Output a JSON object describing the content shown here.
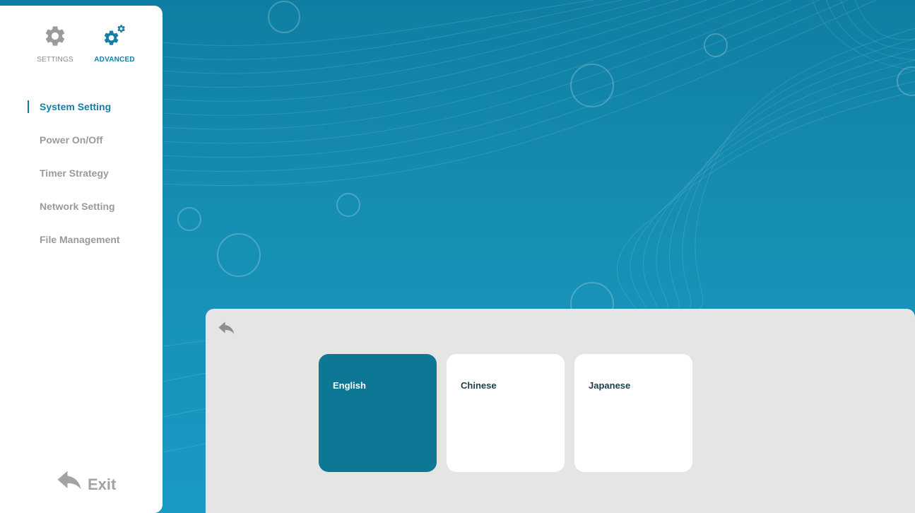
{
  "sidebar": {
    "modes": [
      {
        "label": "SETTINGS",
        "icon": "gear-icon"
      },
      {
        "label": "ADVANCED",
        "icon": "advanced-gears-icon"
      }
    ],
    "items": [
      {
        "label": "System Setting"
      },
      {
        "label": "Power On/Off"
      },
      {
        "label": "Timer Strategy"
      },
      {
        "label": "Network Setting"
      },
      {
        "label": "File Management"
      }
    ],
    "active_item": "System Setting",
    "exit_label": "Exit"
  },
  "panel": {
    "back_icon": "back-arrow-icon",
    "languages": [
      {
        "label": "English",
        "selected": true
      },
      {
        "label": "Chinese",
        "selected": false
      },
      {
        "label": "Japanese",
        "selected": false
      }
    ]
  },
  "colors": {
    "accent": "#137fa4",
    "selected_card": "#0e7796",
    "background_top": "#0f7ea3",
    "background_bottom": "#1a9ac4",
    "panel": "#e5e5e5",
    "muted_text": "#9a9a9a"
  }
}
